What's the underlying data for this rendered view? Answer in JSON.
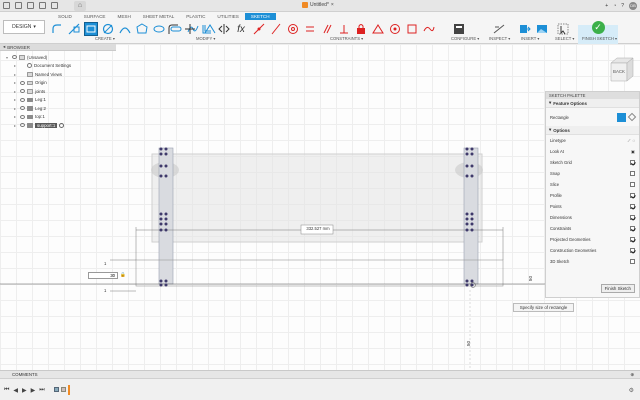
{
  "titlebar": {
    "doc_title": "Untitled*",
    "user_initials": "DB"
  },
  "toolbar": {
    "workspace": "DESIGN",
    "tabs": [
      "SOLID",
      "SURFACE",
      "MESH",
      "SHEET METAL",
      "PLASTIC",
      "UTILITIES",
      "SKETCH"
    ],
    "active_tab": "SKETCH",
    "groups": {
      "create": "CREATE",
      "modify": "MODIFY",
      "constraints": "CONSTRAINTS",
      "configure": "CONFIGURE",
      "inspect": "INSPECT",
      "insert": "INSERT",
      "select": "SELECT",
      "finish_sketch": "FINISH SKETCH"
    }
  },
  "browser": {
    "header": "BROWSER",
    "items": [
      {
        "label": "(Unsaved)"
      },
      {
        "label": "Document Settings"
      },
      {
        "label": "Named Views"
      },
      {
        "label": "Origin"
      },
      {
        "label": "joints"
      },
      {
        "label": "Leg:1"
      },
      {
        "label": "Leg:2"
      },
      {
        "label": "top:1"
      },
      {
        "label": "support:1"
      }
    ]
  },
  "palette": {
    "header": "SKETCH PALETTE",
    "feature_options": "Feature Options",
    "rectangle_label": "Rectangle",
    "options_header": "Options",
    "options": [
      {
        "label": "Linetype",
        "type": "icons"
      },
      {
        "label": "Look At",
        "type": "icon"
      },
      {
        "label": "Sketch Grid",
        "checked": true
      },
      {
        "label": "Snap",
        "checked": false
      },
      {
        "label": "Slice",
        "checked": false
      },
      {
        "label": "Profile",
        "checked": true
      },
      {
        "label": "Points",
        "checked": true
      },
      {
        "label": "Dimensions",
        "checked": true
      },
      {
        "label": "Constraints",
        "checked": true
      },
      {
        "label": "Projected Geometries",
        "checked": true
      },
      {
        "label": "Construction Geometries",
        "checked": true
      },
      {
        "label": "3D Sketch",
        "checked": false
      }
    ],
    "finish_button": "Finish Sketch"
  },
  "canvas": {
    "dimension_label": "332.527 mm",
    "dim_input_value": "30",
    "vert_dim_right": "50",
    "vert_dim_bottom": "50",
    "tick_1a": "1",
    "tick_1b": "1",
    "viewcube_label": "BACK"
  },
  "tooltip": "Specify size of rectangle",
  "comments": "COMMENTS",
  "colors": {
    "accent": "#1d8fd6",
    "finish": "#3cb04a",
    "sketch_point": "#3f3a6b"
  }
}
